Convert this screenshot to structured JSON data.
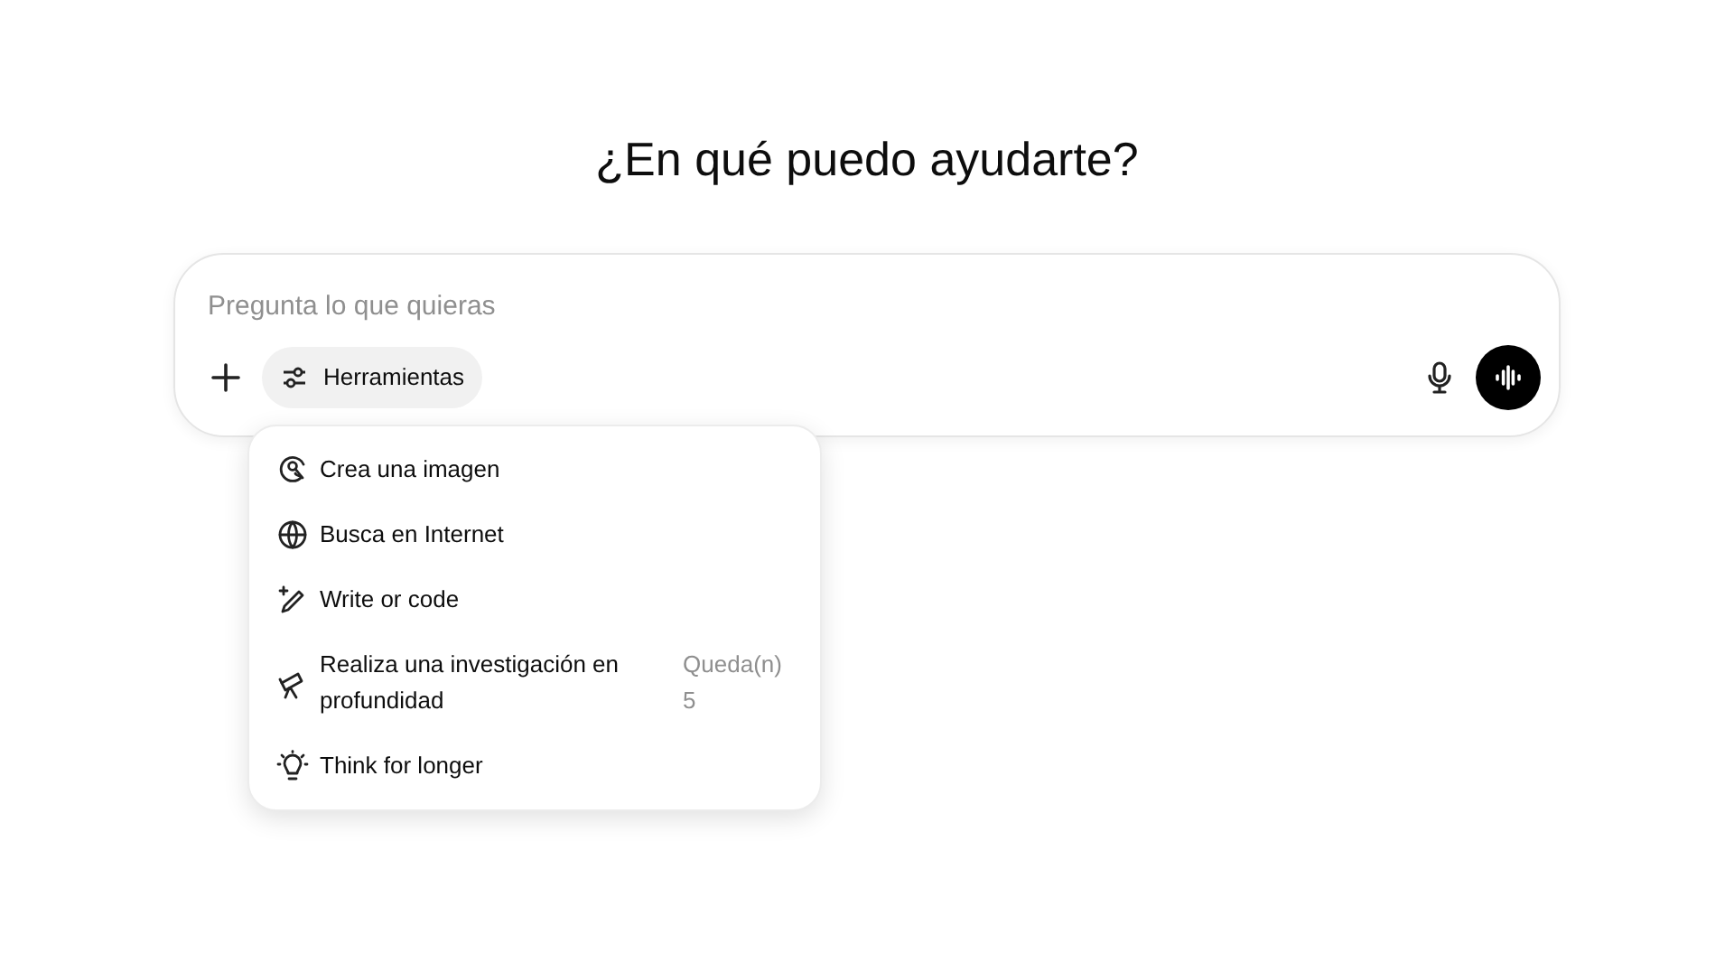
{
  "heading": "¿En qué puedo ayudarte?",
  "composer": {
    "placeholder": "Pregunta lo que quieras",
    "tools_button": "Herramientas"
  },
  "tools_menu": [
    {
      "kind": "image",
      "label": "Crea una imagen"
    },
    {
      "kind": "web",
      "label": "Busca en Internet"
    },
    {
      "kind": "write",
      "label": "Write or code"
    },
    {
      "kind": "research",
      "label": "Realiza una investigación en profundidad",
      "note": "Queda(n) 5"
    },
    {
      "kind": "think",
      "label": "Think for longer"
    }
  ]
}
